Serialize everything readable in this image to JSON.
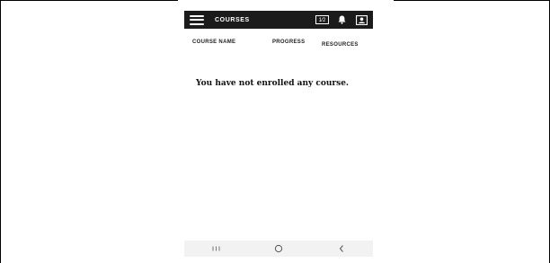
{
  "appbar": {
    "title": "COURSES",
    "language_badge": "1​",
    "icons": [
      "menu-icon",
      "translate-icon",
      "bell-icon",
      "profile-icon"
    ]
  },
  "columns": {
    "course_name": "COURSE NAME",
    "progress": "PROGRESS",
    "resources": "RESOURCES"
  },
  "empty_message": "You have not enrolled any course.",
  "navbar": {
    "icons": [
      "recents-icon",
      "home-icon",
      "back-icon"
    ]
  },
  "colors": {
    "appbar_bg": "#1b1b1b",
    "navbar_bg": "#f2f2f2",
    "text": "#111111"
  }
}
